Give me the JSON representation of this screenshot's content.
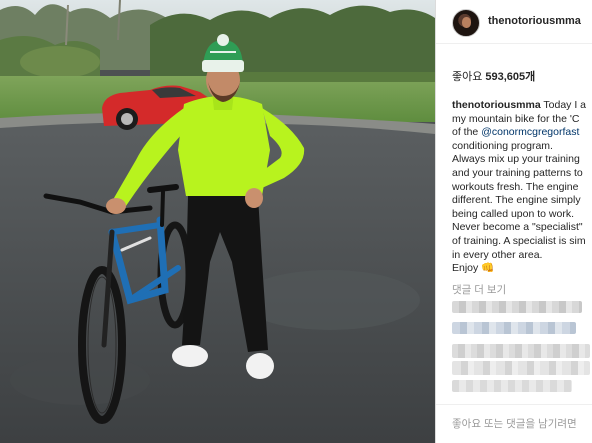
{
  "post": {
    "username": "thenotoriousmma",
    "likes_label": "좋아요",
    "likes_count": "593,605개",
    "caption": {
      "author": "thenotoriousmma",
      "line1": "Today I a",
      "line2": "my mountain bike for the 'C",
      "line3_pre": "of the",
      "mention": "@conormcgregorfast",
      "line4": "conditioning program.",
      "line5": "Always mix up your training",
      "line6": "and your training patterns to",
      "line7": "workouts fresh. The engine",
      "line8": "different. The engine simply",
      "line9": "being called upon to work.",
      "line10": "Never become a \"specialist\"",
      "line11": "of training. A specialist is sim",
      "line12": "in every other area.",
      "line13": "Enjoy",
      "emoji": "👊"
    },
    "more_comments": "댓글 더 보기",
    "comment_placeholder": "좋아요 또는 댓글을 남기려면"
  },
  "colors": {
    "mention": "#003569",
    "muted": "#999999",
    "text": "#262626",
    "jacket": "#b8f31e",
    "bike_frame": "#1f6fb5",
    "car": "#d42a2a"
  },
  "icons": {
    "avatar": "profile-avatar",
    "emoji": "fist-bump-emoji"
  }
}
